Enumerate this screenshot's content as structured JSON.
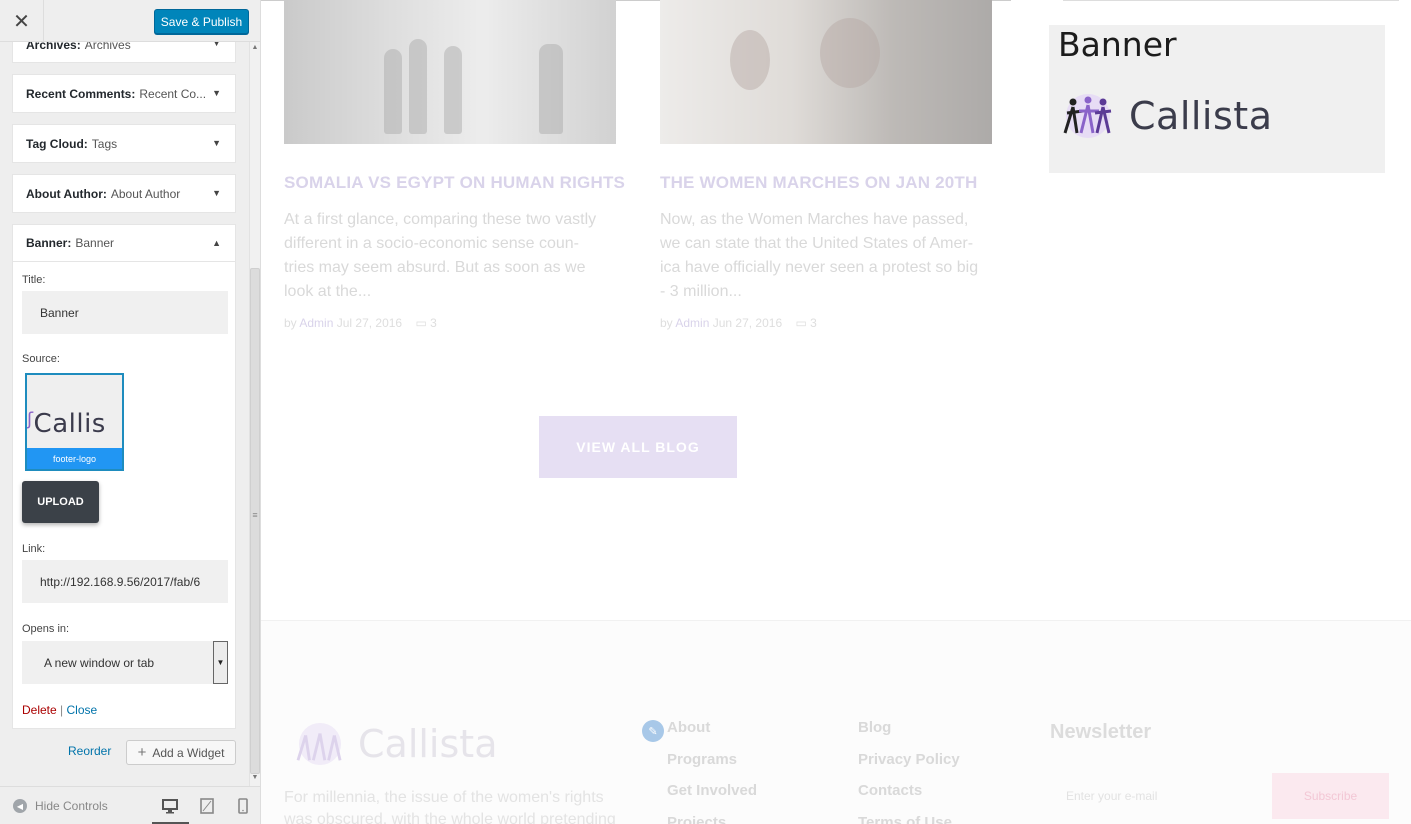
{
  "sidebar": {
    "save_label": "Save & Publish",
    "widgets": [
      {
        "name": "Archives:",
        "sub": "Archives"
      },
      {
        "name": "Recent Comments:",
        "sub": "Recent Co..."
      },
      {
        "name": "Tag Cloud:",
        "sub": "Tags"
      },
      {
        "name": "About Author:",
        "sub": "About Author"
      },
      {
        "name": "Banner:",
        "sub": "Banner"
      }
    ],
    "banner_form": {
      "title_label": "Title:",
      "title_value": "Banner",
      "source_label": "Source:",
      "source_caption": "footer-logo",
      "source_logo_text": "Callis",
      "upload_label": "UPLOAD",
      "link_label": "Link:",
      "link_value": "http://192.168.9.56/2017/fab/6",
      "opens_label": "Opens in:",
      "opens_value": "A new window or tab",
      "delete_label": "Delete",
      "separator": "|",
      "close_label": "Close"
    },
    "reorder_label": "Reorder",
    "add_widget_label": "Add a Widget",
    "hide_controls_label": "Hide Controls"
  },
  "preview": {
    "posts": [
      {
        "title": "SOMALIA VS EGYPT ON HUMAN RIGHTS",
        "excerpt": "At a first glance, comparing these two vastly\ndifferent in a socio-economic sense coun-\ntries may seem absurd. But as soon as we\nlook at the...",
        "by": "by",
        "author": "Admin",
        "date": "Jul 27, 2016",
        "comments": "3"
      },
      {
        "title": "THE WOMEN MARCHES ON JAN 20TH",
        "excerpt": "Now, as the Women Marches have passed,\nwe can state that the United States of Amer-\nica have officially never seen a protest so big\n- 3 million...",
        "by": "by",
        "author": "Admin",
        "date": "Jun 27, 2016",
        "comments": "3"
      }
    ],
    "view_all_label": "VIEW ALL BLOG",
    "banner": {
      "heading": "Banner",
      "logo_text": "Callista"
    },
    "footer": {
      "logo_text": "Callista",
      "about": "For millennia, the issue of the women's rights was obscured, with the whole world pretending",
      "links_col1": [
        "About",
        "Programs",
        "Get Involved",
        "Projects"
      ],
      "links_col2": [
        "Blog",
        "Privacy Policy",
        "Contacts",
        "Terms of Use"
      ],
      "newsletter_heading": "Newsletter",
      "newsletter_placeholder": "Enter your e-mail",
      "subscribe_label": "Subscribe"
    }
  },
  "colors": {
    "accent": "#0085ba",
    "brand_purple": "#8a63c9",
    "thumb_caption": "#2196f3"
  },
  "icons": [
    "close-icon",
    "chevron-down-icon",
    "chevron-up-icon",
    "plus-icon",
    "desktop-icon",
    "tablet-icon",
    "mobile-icon",
    "pencil-icon",
    "comment-icon"
  ]
}
